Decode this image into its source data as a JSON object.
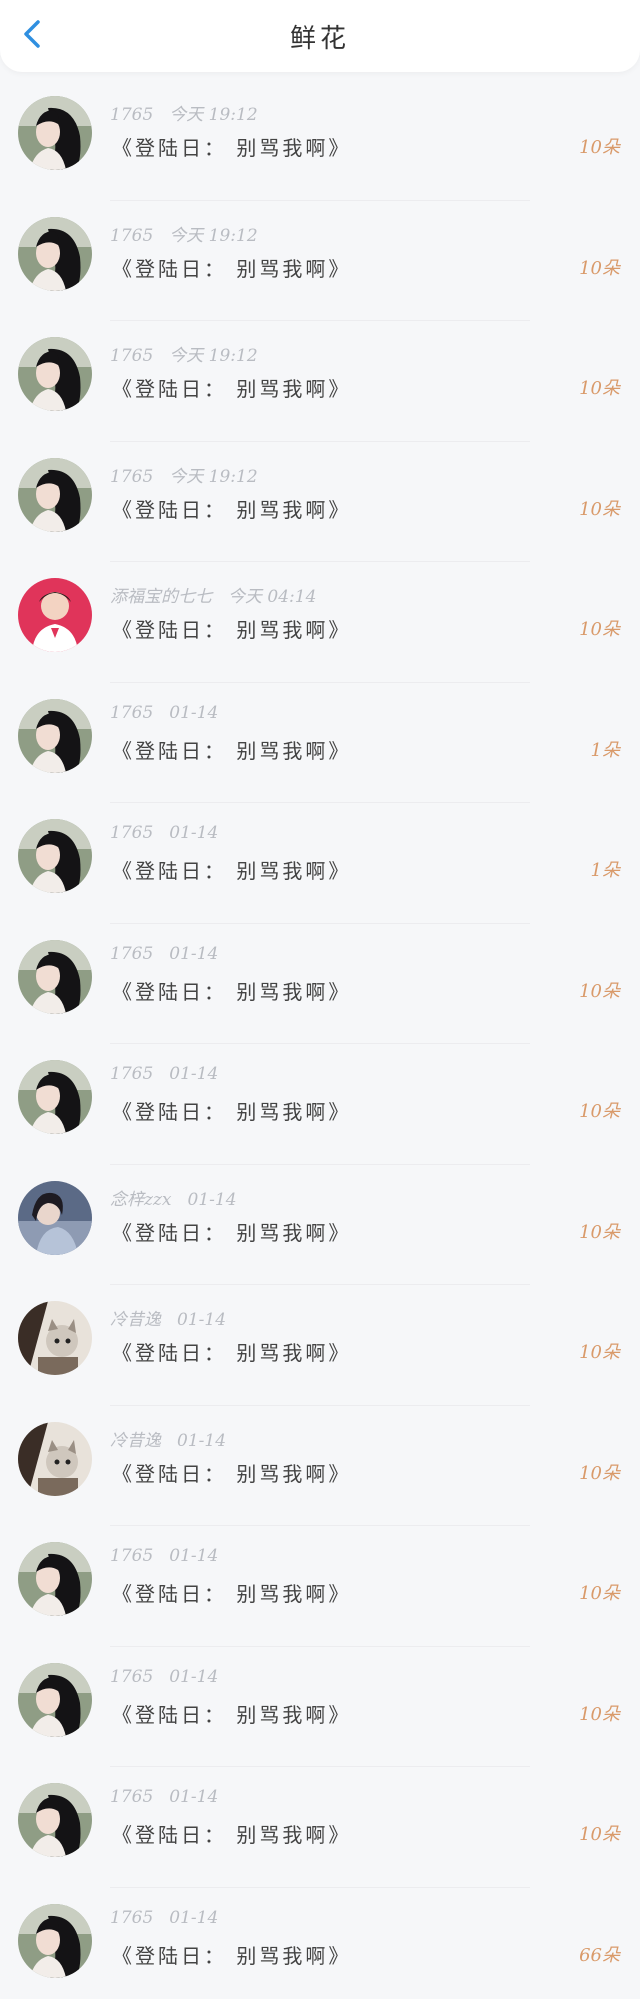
{
  "header": {
    "title": "鲜花",
    "back_icon": "chevron-left-icon",
    "accent_color": "#2f8fe0"
  },
  "colors": {
    "count": "#d99a6a",
    "meta": "#b9bcc2"
  },
  "records": [
    {
      "name": "1765",
      "time": "今天 19:12",
      "message": "《登陆日： 别骂我啊》",
      "count": "10朵",
      "avatar": "girl"
    },
    {
      "name": "1765",
      "time": "今天 19:12",
      "message": "《登陆日： 别骂我啊》",
      "count": "10朵",
      "avatar": "girl"
    },
    {
      "name": "1765",
      "time": "今天 19:12",
      "message": "《登陆日： 别骂我啊》",
      "count": "10朵",
      "avatar": "girl"
    },
    {
      "name": "1765",
      "time": "今天 19:12",
      "message": "《登陆日： 别骂我啊》",
      "count": "10朵",
      "avatar": "girl"
    },
    {
      "name": "添福宝的七七",
      "time": "今天 04:14",
      "message": "《登陆日： 别骂我啊》",
      "count": "10朵",
      "avatar": "boy-red"
    },
    {
      "name": "1765",
      "time": "01-14",
      "message": "《登陆日： 别骂我啊》",
      "count": "1朵",
      "avatar": "girl"
    },
    {
      "name": "1765",
      "time": "01-14",
      "message": "《登陆日： 别骂我啊》",
      "count": "1朵",
      "avatar": "girl"
    },
    {
      "name": "1765",
      "time": "01-14",
      "message": "《登陆日： 别骂我啊》",
      "count": "10朵",
      "avatar": "girl"
    },
    {
      "name": "1765",
      "time": "01-14",
      "message": "《登陆日： 别骂我啊》",
      "count": "10朵",
      "avatar": "girl"
    },
    {
      "name": "念梓zzx",
      "time": "01-14",
      "message": "《登陆日： 别骂我啊》",
      "count": "10朵",
      "avatar": "blue-girl"
    },
    {
      "name": "冷昔逸",
      "time": "01-14",
      "message": "《登陆日： 别骂我啊》",
      "count": "10朵",
      "avatar": "cat"
    },
    {
      "name": "冷昔逸",
      "time": "01-14",
      "message": "《登陆日： 别骂我啊》",
      "count": "10朵",
      "avatar": "cat"
    },
    {
      "name": "1765",
      "time": "01-14",
      "message": "《登陆日： 别骂我啊》",
      "count": "10朵",
      "avatar": "girl"
    },
    {
      "name": "1765",
      "time": "01-14",
      "message": "《登陆日： 别骂我啊》",
      "count": "10朵",
      "avatar": "girl"
    },
    {
      "name": "1765",
      "time": "01-14",
      "message": "《登陆日： 别骂我啊》",
      "count": "10朵",
      "avatar": "girl"
    },
    {
      "name": "1765",
      "time": "01-14",
      "message": "《登陆日： 别骂我啊》",
      "count": "66朵",
      "avatar": "girl"
    }
  ]
}
